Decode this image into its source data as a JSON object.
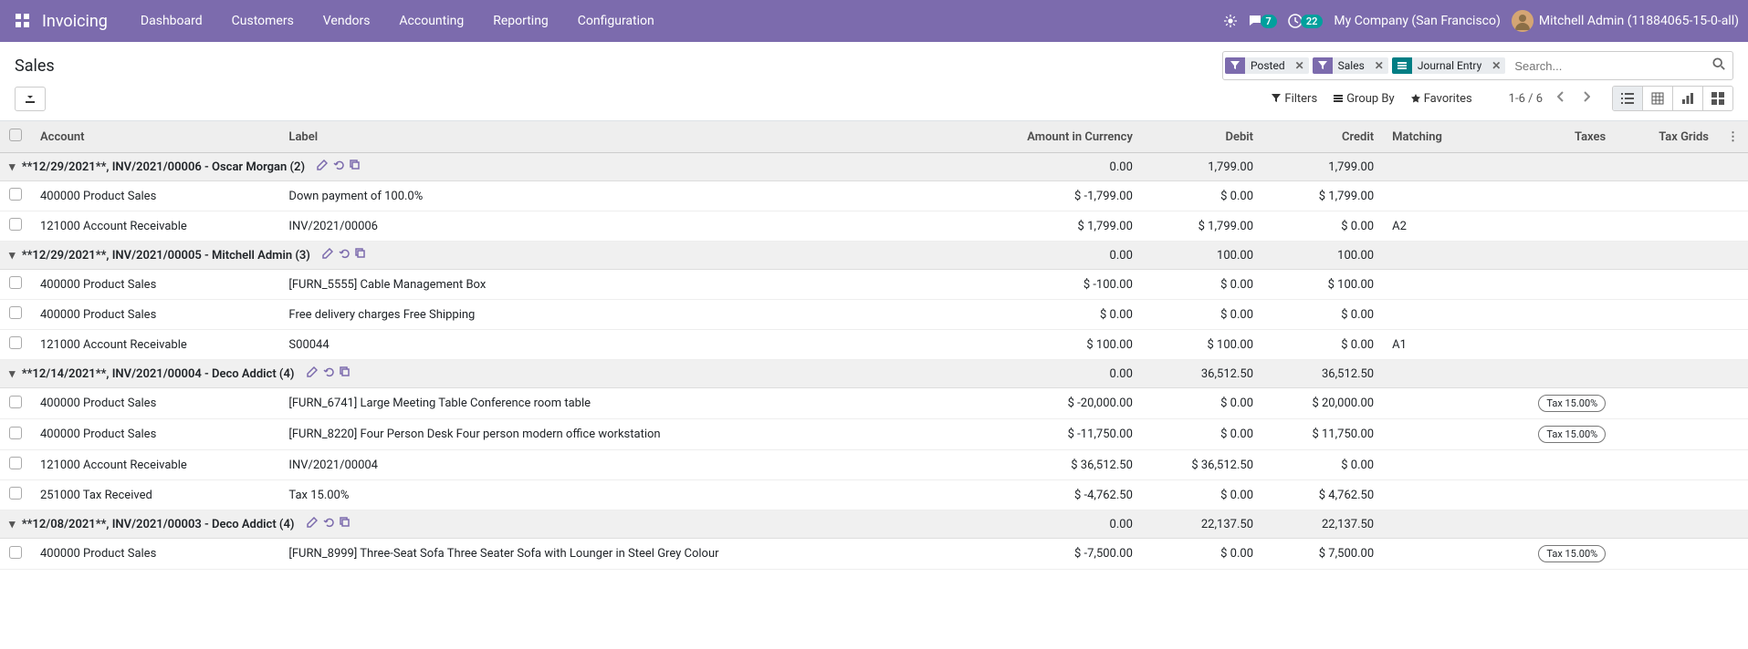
{
  "navbar": {
    "brand": "Invoicing",
    "menu": [
      "Dashboard",
      "Customers",
      "Vendors",
      "Accounting",
      "Reporting",
      "Configuration"
    ],
    "chat_badge": "7",
    "activity_badge": "22",
    "company": "My Company (San Francisco)",
    "user": "Mitchell Admin (11884065-15-0-all)"
  },
  "breadcrumb": "Sales",
  "search": {
    "facets": [
      {
        "type": "filter",
        "label": "Posted"
      },
      {
        "type": "filter",
        "label": "Sales"
      },
      {
        "type": "group",
        "label": "Journal Entry"
      }
    ],
    "placeholder": "Search..."
  },
  "search_options": {
    "filters": "Filters",
    "groupby": "Group By",
    "favorites": "Favorites"
  },
  "pager": "1-6 / 6",
  "columns": {
    "account": "Account",
    "label": "Label",
    "amount_currency": "Amount in Currency",
    "debit": "Debit",
    "credit": "Credit",
    "matching": "Matching",
    "taxes": "Taxes",
    "tax_grids": "Tax Grids"
  },
  "groups": [
    {
      "title": "**12/29/2021**, INV/2021/00006 - Oscar Morgan (2)",
      "amount_currency": "0.00",
      "debit": "1,799.00",
      "credit": "1,799.00",
      "lines": [
        {
          "account": "400000 Product Sales",
          "label": "Down payment of 100.0%",
          "amount_currency": "$ -1,799.00",
          "debit": "$ 0.00",
          "credit": "$ 1,799.00",
          "matching": "",
          "taxes": "",
          "tax_grids": ""
        },
        {
          "account": "121000 Account Receivable",
          "label": "INV/2021/00006",
          "amount_currency": "$ 1,799.00",
          "debit": "$ 1,799.00",
          "credit": "$ 0.00",
          "matching": "A2",
          "taxes": "",
          "tax_grids": ""
        }
      ]
    },
    {
      "title": "**12/29/2021**, INV/2021/00005 - Mitchell Admin (3)",
      "amount_currency": "0.00",
      "debit": "100.00",
      "credit": "100.00",
      "lines": [
        {
          "account": "400000 Product Sales",
          "label": "[FURN_5555] Cable Management Box",
          "amount_currency": "$ -100.00",
          "debit": "$ 0.00",
          "credit": "$ 100.00",
          "matching": "",
          "taxes": "",
          "tax_grids": ""
        },
        {
          "account": "400000 Product Sales",
          "label": "Free delivery charges Free Shipping",
          "amount_currency": "$ 0.00",
          "debit": "$ 0.00",
          "credit": "$ 0.00",
          "matching": "",
          "taxes": "",
          "tax_grids": ""
        },
        {
          "account": "121000 Account Receivable",
          "label": "S00044",
          "amount_currency": "$ 100.00",
          "debit": "$ 100.00",
          "credit": "$ 0.00",
          "matching": "A1",
          "taxes": "",
          "tax_grids": ""
        }
      ]
    },
    {
      "title": "**12/14/2021**, INV/2021/00004 - Deco Addict (4)",
      "amount_currency": "0.00",
      "debit": "36,512.50",
      "credit": "36,512.50",
      "lines": [
        {
          "account": "400000 Product Sales",
          "label": "[FURN_6741] Large Meeting Table Conference room table",
          "amount_currency": "$ -20,000.00",
          "debit": "$ 0.00",
          "credit": "$ 20,000.00",
          "matching": "",
          "taxes": "Tax 15.00%",
          "tax_grids": ""
        },
        {
          "account": "400000 Product Sales",
          "label": "[FURN_8220] Four Person Desk Four person modern office workstation",
          "amount_currency": "$ -11,750.00",
          "debit": "$ 0.00",
          "credit": "$ 11,750.00",
          "matching": "",
          "taxes": "Tax 15.00%",
          "tax_grids": ""
        },
        {
          "account": "121000 Account Receivable",
          "label": "INV/2021/00004",
          "amount_currency": "$ 36,512.50",
          "debit": "$ 36,512.50",
          "credit": "$ 0.00",
          "matching": "",
          "taxes": "",
          "tax_grids": ""
        },
        {
          "account": "251000 Tax Received",
          "label": "Tax 15.00%",
          "amount_currency": "$ -4,762.50",
          "debit": "$ 0.00",
          "credit": "$ 4,762.50",
          "matching": "",
          "taxes": "",
          "tax_grids": ""
        }
      ]
    },
    {
      "title": "**12/08/2021**, INV/2021/00003 - Deco Addict (4)",
      "amount_currency": "0.00",
      "debit": "22,137.50",
      "credit": "22,137.50",
      "lines": [
        {
          "account": "400000 Product Sales",
          "label": "[FURN_8999] Three-Seat Sofa Three Seater Sofa with Lounger in Steel Grey Colour",
          "amount_currency": "$ -7,500.00",
          "debit": "$ 0.00",
          "credit": "$ 7,500.00",
          "matching": "",
          "taxes": "Tax 15.00%",
          "tax_grids": ""
        }
      ]
    }
  ]
}
